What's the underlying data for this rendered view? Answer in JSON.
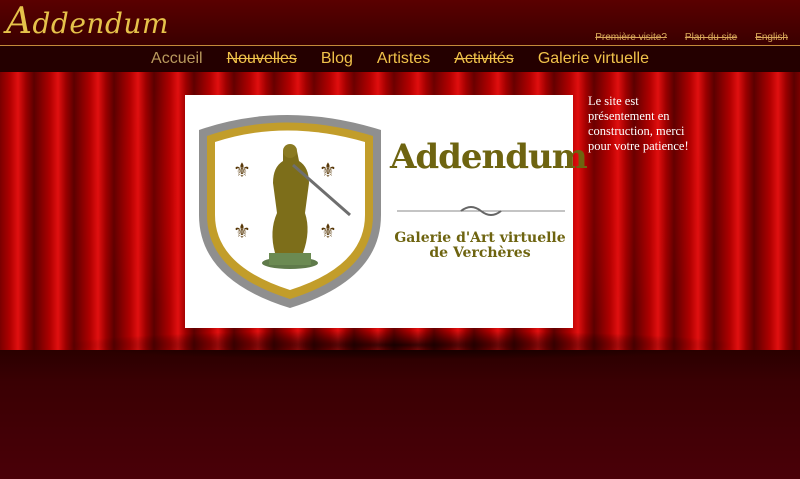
{
  "site": {
    "logo_text": "ddendum",
    "logo_initial": "A"
  },
  "utility_links": [
    {
      "label": "Première visite?"
    },
    {
      "label": "Plan du site"
    },
    {
      "label": "English"
    }
  ],
  "nav": [
    {
      "label": "Accueil",
      "active": true,
      "strike": false
    },
    {
      "label": "Nouvelles",
      "active": false,
      "strike": true
    },
    {
      "label": "Blog",
      "active": false,
      "strike": false
    },
    {
      "label": "Artistes",
      "active": false,
      "strike": false
    },
    {
      "label": "Activités",
      "active": false,
      "strike": true
    },
    {
      "label": "Galerie virtuelle",
      "active": false,
      "strike": false
    }
  ],
  "banner": {
    "title": "Addendum",
    "subtitle_line1": "Galerie d'Art virtuelle",
    "subtitle_line2": "de Verchères"
  },
  "notice": {
    "text": "Le site est présentement en construction, merci pour votre patience!"
  },
  "colors": {
    "gold": "#f0c24a",
    "header": "#3a0000",
    "curtain": "#b00000",
    "olive": "#6e6410"
  }
}
